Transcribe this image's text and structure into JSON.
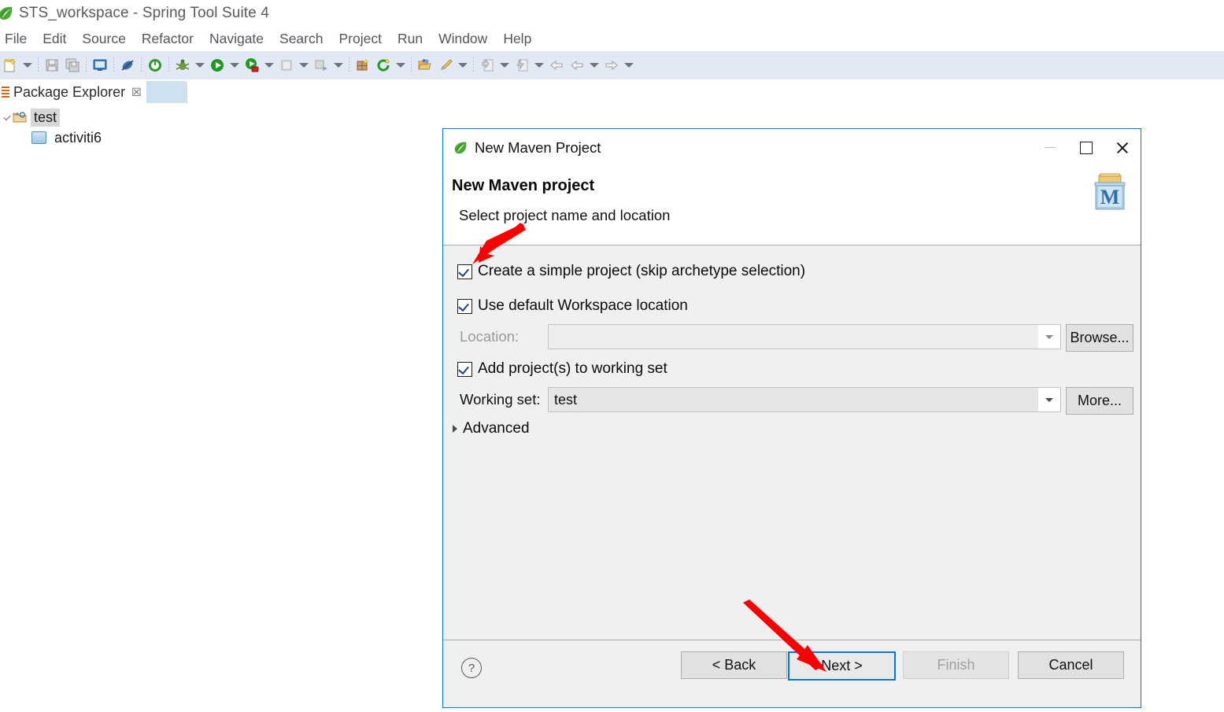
{
  "window": {
    "title": "STS_workspace - Spring Tool Suite 4",
    "app_icon": "spring-leaf-icon"
  },
  "menubar": {
    "items": [
      {
        "label": "File"
      },
      {
        "label": "Edit"
      },
      {
        "label": "Source"
      },
      {
        "label": "Refactor"
      },
      {
        "label": "Navigate"
      },
      {
        "label": "Search"
      },
      {
        "label": "Project"
      },
      {
        "label": "Run"
      },
      {
        "label": "Window"
      },
      {
        "label": "Help"
      }
    ]
  },
  "toolbar": {
    "items": [
      {
        "name": "new-wizard-icon"
      },
      {
        "name": "new-wizard-dropdown"
      },
      {
        "name": "separator"
      },
      {
        "name": "save-icon"
      },
      {
        "name": "save-all-icon"
      },
      {
        "name": "separator"
      },
      {
        "name": "open-console-icon"
      },
      {
        "name": "separator"
      },
      {
        "name": "skip-breakpoints-icon"
      },
      {
        "name": "separator"
      },
      {
        "name": "boot-dashboard-icon"
      },
      {
        "name": "separator"
      },
      {
        "name": "debug-icon"
      },
      {
        "name": "debug-dropdown"
      },
      {
        "name": "run-icon"
      },
      {
        "name": "run-dropdown"
      },
      {
        "name": "run-as-server-icon"
      },
      {
        "name": "run-as-server-dropdown"
      },
      {
        "name": "terminate-icon"
      },
      {
        "name": "terminate-dropdown"
      },
      {
        "name": "relaunch-icon"
      },
      {
        "name": "relaunch-dropdown"
      },
      {
        "name": "separator"
      },
      {
        "name": "new-java-package-icon"
      },
      {
        "name": "refresh-icon"
      },
      {
        "name": "refresh-dropdown"
      },
      {
        "name": "separator"
      },
      {
        "name": "open-type-icon"
      },
      {
        "name": "quickfix-icon"
      },
      {
        "name": "quickfix-dropdown"
      },
      {
        "name": "separator"
      },
      {
        "name": "next-annotation-icon"
      },
      {
        "name": "next-annotation-dropdown"
      },
      {
        "name": "previous-annotation-icon"
      },
      {
        "name": "previous-annotation-dropdown"
      },
      {
        "name": "back-icon"
      },
      {
        "name": "back-dropdown"
      },
      {
        "name": "forward-icon"
      },
      {
        "name": "forward-dropdown"
      }
    ]
  },
  "package_explorer": {
    "tab_label": "Package Explorer",
    "tab_icon": "package-explorer-icon",
    "close_glyph": "☒",
    "tree": [
      {
        "label": "test",
        "icon": "java-project-icon",
        "level": 1,
        "expanded": true,
        "selected": true
      },
      {
        "label": "activiti6",
        "icon": "package-folder-icon",
        "level": 2,
        "expanded": false,
        "selected": false
      }
    ]
  },
  "dialog": {
    "window_title": "New Maven Project",
    "window_icon": "spring-leaf-icon",
    "window_buttons": {
      "minimize": "minimize-icon",
      "maximize": "maximize-icon",
      "close": "close-icon"
    },
    "heading": "New Maven project",
    "subheading": "Select project name and location",
    "banner_icon": "maven-project-icon",
    "banner_icon_letter": "M",
    "checkboxes": {
      "simple_project": {
        "label": "Create a simple project (skip archetype selection)",
        "checked": true
      },
      "default_location": {
        "label": "Use default Workspace location",
        "checked": true
      },
      "working_set": {
        "label": "Add project(s) to working set",
        "checked": true
      }
    },
    "location": {
      "label": "Location:",
      "value": "",
      "placeholder": "",
      "enabled": false,
      "browse_label": "Browse..."
    },
    "working_set": {
      "label": "Working set:",
      "value": "test",
      "enabled": true,
      "more_label": "More..."
    },
    "advanced": {
      "label": "Advanced",
      "expanded": false
    },
    "footer": {
      "help_glyph": "?",
      "buttons": [
        {
          "label": "< Back",
          "state": "enabled",
          "name": "back-button"
        },
        {
          "label": "Next >",
          "state": "focused",
          "name": "next-button"
        },
        {
          "label": "Finish",
          "state": "disabled",
          "name": "finish-button"
        },
        {
          "label": "Cancel",
          "state": "enabled",
          "name": "cancel-button"
        }
      ]
    }
  },
  "annotations": {
    "accent_color": "#fa0000",
    "arrows": [
      {
        "name": "arrow-to-simple-project-checkbox",
        "points_to": "simple-project-checkbox"
      },
      {
        "name": "arrow-to-next-button",
        "points_to": "next-button"
      }
    ]
  },
  "colors": {
    "toolbar_bg": "#e3e8f5",
    "dialog_bg": "#f0f0f0",
    "dialog_border": "#0078d7",
    "focus_blue": "#0078d7",
    "annotation_red": "#fa0000",
    "selection_gray": "#d6d6d6"
  }
}
